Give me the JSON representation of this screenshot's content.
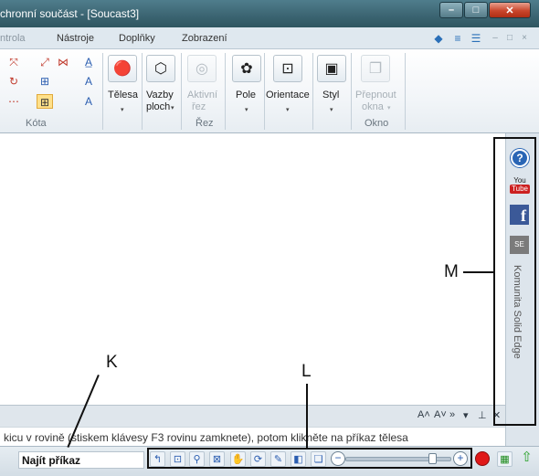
{
  "window": {
    "title": "chronní součást - [Soucast3]",
    "min_glyph": "–",
    "max_glyph": "□",
    "close_glyph": "✕"
  },
  "tabs": {
    "items": [
      {
        "label": "ntrola",
        "faded": true
      },
      {
        "label": "Nástroje"
      },
      {
        "label": "Doplňky"
      },
      {
        "label": "Zobrazení"
      }
    ]
  },
  "ribbon": {
    "kota_group_label": "Kóta",
    "rez_group_label": "Řez",
    "okno_group_label": "Okno",
    "buttons": {
      "telesa": "Tělesa",
      "vazby_line1": "Vazby",
      "vazby_line2": "ploch",
      "aktivni_line1": "Aktivní",
      "aktivni_line2": "řez",
      "pole": "Pole",
      "orientace": "Orientace",
      "styl": "Styl",
      "prepnout_line1": "Přepnout",
      "prepnout_line2": "okna"
    },
    "dropdown_glyph": "▾"
  },
  "side_panel": {
    "help": "?",
    "youtube_you": "You",
    "youtube_tube": "Tube",
    "facebook": "f",
    "community_icon_text": "SE",
    "community_label": "Komunita Solid Edge"
  },
  "prompt_bar": {
    "font_up": "A˄",
    "font_down": "A˅",
    "expand": "»",
    "collapse": "▾",
    "pin": "⊥",
    "close": "✕",
    "prompt_text": "kicu v rovině (stiskem klávesy F3 rovinu zamknete), potom klikněte na příkaz tělesa"
  },
  "status_bar": {
    "find_command": "Najít příkaz",
    "zoom_minus": "−",
    "zoom_plus": "+",
    "zoom_level": 0.85
  },
  "callouts": {
    "k": "K",
    "l": "L",
    "m": "M"
  }
}
